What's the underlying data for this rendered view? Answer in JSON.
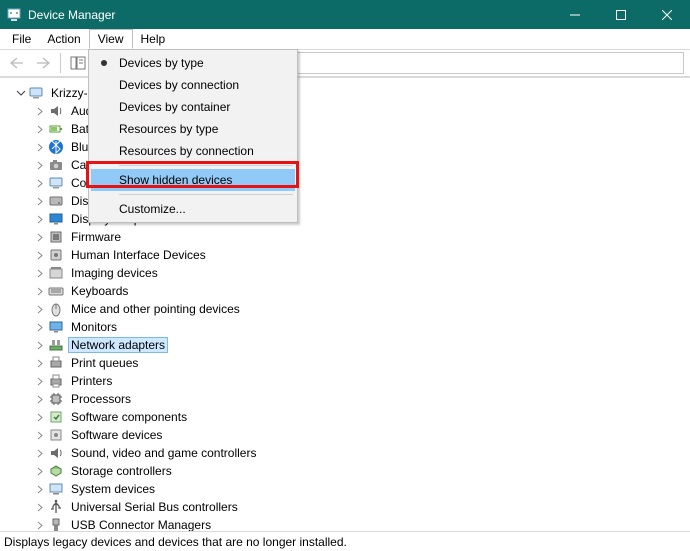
{
  "window": {
    "title": "Device Manager"
  },
  "menubar": {
    "file": "File",
    "action": "Action",
    "view": "View",
    "help": "Help"
  },
  "view_menu": {
    "devices_by_type": "Devices by type",
    "devices_by_connection": "Devices by connection",
    "devices_by_container": "Devices by container",
    "resources_by_type": "Resources by type",
    "resources_by_connection": "Resources by connection",
    "show_hidden_devices": "Show hidden devices",
    "customize": "Customize..."
  },
  "tree": {
    "root": "Krizzy-D",
    "items": [
      {
        "label": "Audio inputs and outputs",
        "icon": "audio-icon"
      },
      {
        "label": "Batteries",
        "icon": "battery-icon"
      },
      {
        "label": "Bluetooth",
        "icon": "bluetooth-icon"
      },
      {
        "label": "Cameras",
        "icon": "camera-icon"
      },
      {
        "label": "Computer",
        "icon": "computer-icon"
      },
      {
        "label": "Disk drives",
        "icon": "disk-icon"
      },
      {
        "label": "Display adapters",
        "icon": "display-icon"
      },
      {
        "label": "Firmware",
        "icon": "firmware-icon"
      },
      {
        "label": "Human Interface Devices",
        "icon": "hid-icon"
      },
      {
        "label": "Imaging devices",
        "icon": "imaging-icon"
      },
      {
        "label": "Keyboards",
        "icon": "keyboard-icon"
      },
      {
        "label": "Mice and other pointing devices",
        "icon": "mouse-icon"
      },
      {
        "label": "Monitors",
        "icon": "monitor-icon"
      },
      {
        "label": "Network adapters",
        "icon": "network-icon",
        "selected": true
      },
      {
        "label": "Print queues",
        "icon": "printqueue-icon"
      },
      {
        "label": "Printers",
        "icon": "printer-icon"
      },
      {
        "label": "Processors",
        "icon": "processor-icon"
      },
      {
        "label": "Software components",
        "icon": "swcomp-icon"
      },
      {
        "label": "Software devices",
        "icon": "swdev-icon"
      },
      {
        "label": "Sound, video and game controllers",
        "icon": "sound-icon"
      },
      {
        "label": "Storage controllers",
        "icon": "storage-icon"
      },
      {
        "label": "System devices",
        "icon": "system-icon"
      },
      {
        "label": "Universal Serial Bus controllers",
        "icon": "usb-icon"
      },
      {
        "label": "USB Connector Managers",
        "icon": "usbconn-icon"
      }
    ]
  },
  "statusbar": {
    "text": "Displays legacy devices and devices that are no longer installed."
  },
  "colors": {
    "titlebar_bg": "#0c6b66",
    "highlight_red": "#e51313",
    "menu_hover": "#91c9f7",
    "selection_bg": "#cde8ff"
  }
}
